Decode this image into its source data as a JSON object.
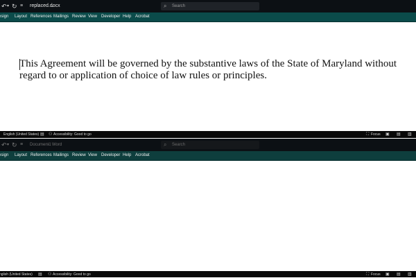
{
  "window1": {
    "titlebar": {
      "filename": "replaced.docx",
      "search_placeholder": "Search"
    },
    "tabs": [
      "esign",
      "Layout",
      "References",
      "Mailings",
      "Review",
      "View",
      "Developer",
      "Help",
      "Acrobat"
    ],
    "document": {
      "paragraph": "This Agreement will be governed by the substantive laws of the State of Maryland without regard to or application of choice of law rules or principles."
    },
    "statusbar": {
      "language": "English (United States)",
      "accessibility": "Accessibility: Good to go",
      "focus": "Focus"
    }
  },
  "window2": {
    "titlebar": {
      "doc_name": "Document1",
      "separator": "-",
      "app_name": "Word",
      "search_placeholder": "Search"
    },
    "tabs": [
      "esign",
      "Layout",
      "References",
      "Mailings",
      "Review",
      "View",
      "Developer",
      "Help",
      "Acrobat"
    ],
    "statusbar": {
      "language": "nglish (United States)",
      "accessibility": "Accessibility: Good to go",
      "focus": "Focus"
    }
  },
  "colors": {
    "titlebar": "#0c1014",
    "ribbon": "#0b4b4a",
    "statusbar": "#080808"
  }
}
